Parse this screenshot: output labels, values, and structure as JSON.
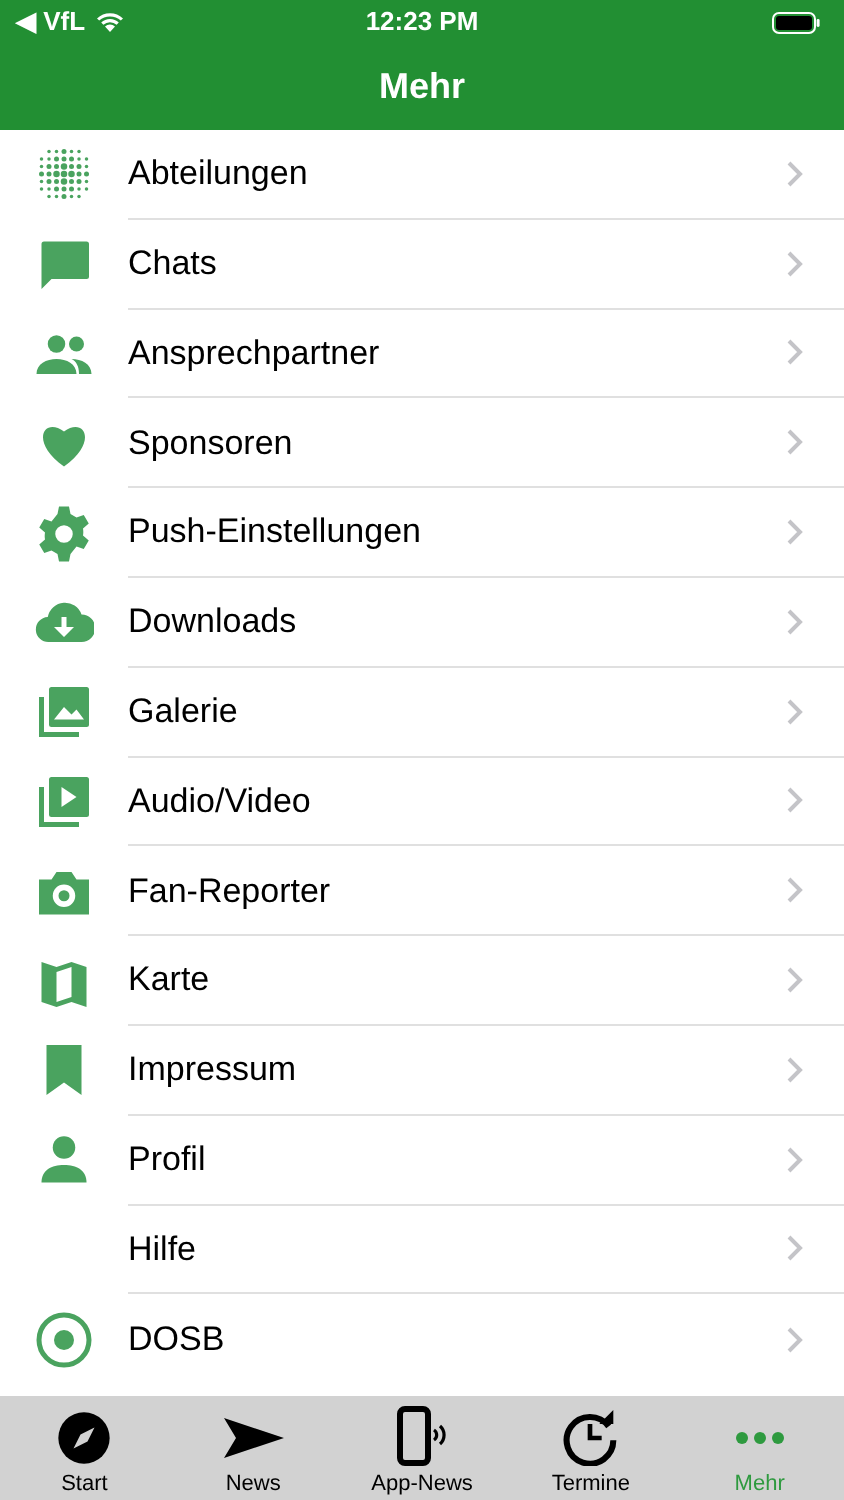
{
  "status_bar": {
    "back": "◀ VfL",
    "time": "12:23 PM"
  },
  "nav": {
    "title": "Mehr"
  },
  "items": [
    {
      "label": "Abteilungen"
    },
    {
      "label": "Chats"
    },
    {
      "label": "Ansprechpartner"
    },
    {
      "label": "Sponsoren"
    },
    {
      "label": "Push-Einstellungen"
    },
    {
      "label": "Downloads"
    },
    {
      "label": "Galerie"
    },
    {
      "label": "Audio/Video"
    },
    {
      "label": "Fan-Reporter"
    },
    {
      "label": "Karte"
    },
    {
      "label": "Impressum"
    },
    {
      "label": "Profil"
    },
    {
      "label": "Hilfe"
    },
    {
      "label": "DOSB"
    }
  ],
  "tabs": [
    {
      "label": "Start",
      "selected": false
    },
    {
      "label": "News",
      "selected": false
    },
    {
      "label": "App-News",
      "selected": false
    },
    {
      "label": "Termine",
      "selected": false
    },
    {
      "label": "Mehr",
      "selected": true
    }
  ]
}
